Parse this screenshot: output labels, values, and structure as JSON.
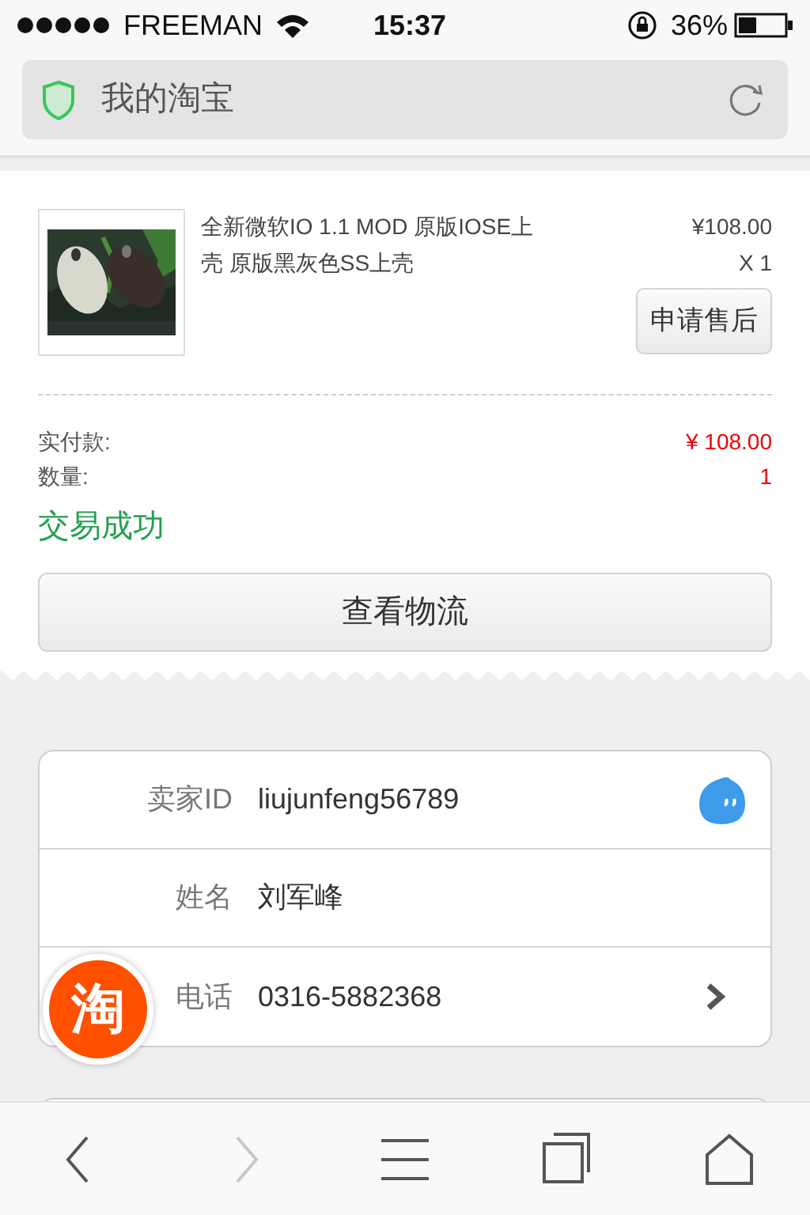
{
  "status_bar": {
    "carrier": "FREEMAN",
    "time": "15:37",
    "battery": "36%"
  },
  "address_bar": {
    "title": "我的淘宝"
  },
  "order": {
    "item": {
      "kind": "picture",
      "title": "全新微软IO 1.1 MOD 原版IOSE上壳 原版黑灰色SS上壳",
      "price": "¥108.00",
      "quantity": "X 1",
      "after_sales_button": "申请售后"
    },
    "summary": [
      {
        "label": "实付款:",
        "value": "¥ 108.00"
      },
      {
        "label": "数量:",
        "value": "1"
      }
    ],
    "status": "交易成功",
    "logistics_button": "查看物流"
  },
  "seller": {
    "rows": [
      {
        "label": "卖家ID",
        "value": "liujunfeng56789",
        "kind": "chat"
      },
      {
        "label": "姓名",
        "value": "刘军峰",
        "kind": "plain"
      },
      {
        "label": "电话",
        "value": "0316-5882368",
        "kind": "link"
      }
    ]
  },
  "floating_button": {
    "text": "淘"
  },
  "toolbar": [
    {
      "kind": "back",
      "disabled": false
    },
    {
      "kind": "forward",
      "disabled": true
    },
    {
      "kind": "menu",
      "disabled": false
    },
    {
      "kind": "tabs",
      "disabled": false
    },
    {
      "kind": "home",
      "disabled": false
    }
  ]
}
